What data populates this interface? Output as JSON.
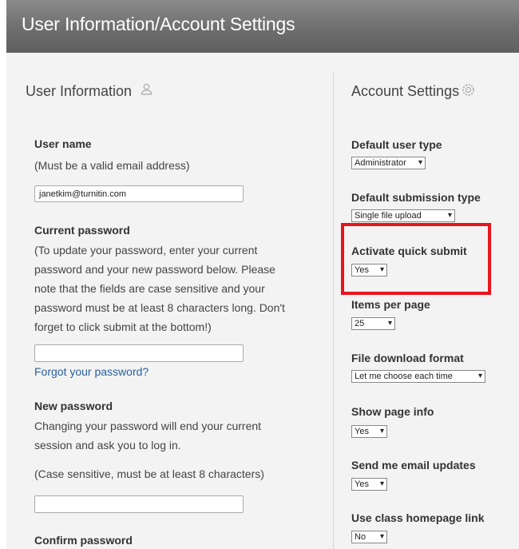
{
  "header": {
    "title": "User Information/Account Settings"
  },
  "user_info": {
    "section_title": "User Information",
    "section_icon": "person-icon",
    "username_label": "User name",
    "username_hint": "(Must be a valid email address)",
    "username_value": "janetkim@turnitin.com",
    "current_password_label": "Current password",
    "current_password_hint": [
      "(To update your password, enter your current",
      "password and your new password below. Please",
      "note that the fields are case sensitive and your",
      "password must be at least 8 characters long. Don't",
      "forget to click submit at the bottom!)"
    ],
    "current_password_value": "",
    "forgot_password_link": "Forgot your password?",
    "new_password_label": "New password",
    "new_password_hint": [
      "Changing your password will end your current",
      "session and ask you to log in."
    ],
    "new_password_note": "(Case sensitive, must be at least 8 characters)",
    "new_password_value": "",
    "confirm_password_label": "Confirm password"
  },
  "account_settings": {
    "section_title": "Account Settings",
    "section_icon": "gear-icon",
    "fields": [
      {
        "label": "Default user type",
        "value": "Administrator"
      },
      {
        "label": "Default submission type",
        "value": "Single file upload"
      },
      {
        "label": "Activate quick submit",
        "value": "Yes"
      },
      {
        "label": "Items per page",
        "value": "25"
      },
      {
        "label": "File download format",
        "value": "Let me choose each time"
      },
      {
        "label": "Show page info",
        "value": "Yes"
      },
      {
        "label": "Send me email updates",
        "value": "Yes"
      },
      {
        "label": "Use class homepage link",
        "value": "No"
      }
    ]
  },
  "annotation": {
    "highlight_color": "#e8141c",
    "highlighted_field": "Activate quick submit"
  }
}
